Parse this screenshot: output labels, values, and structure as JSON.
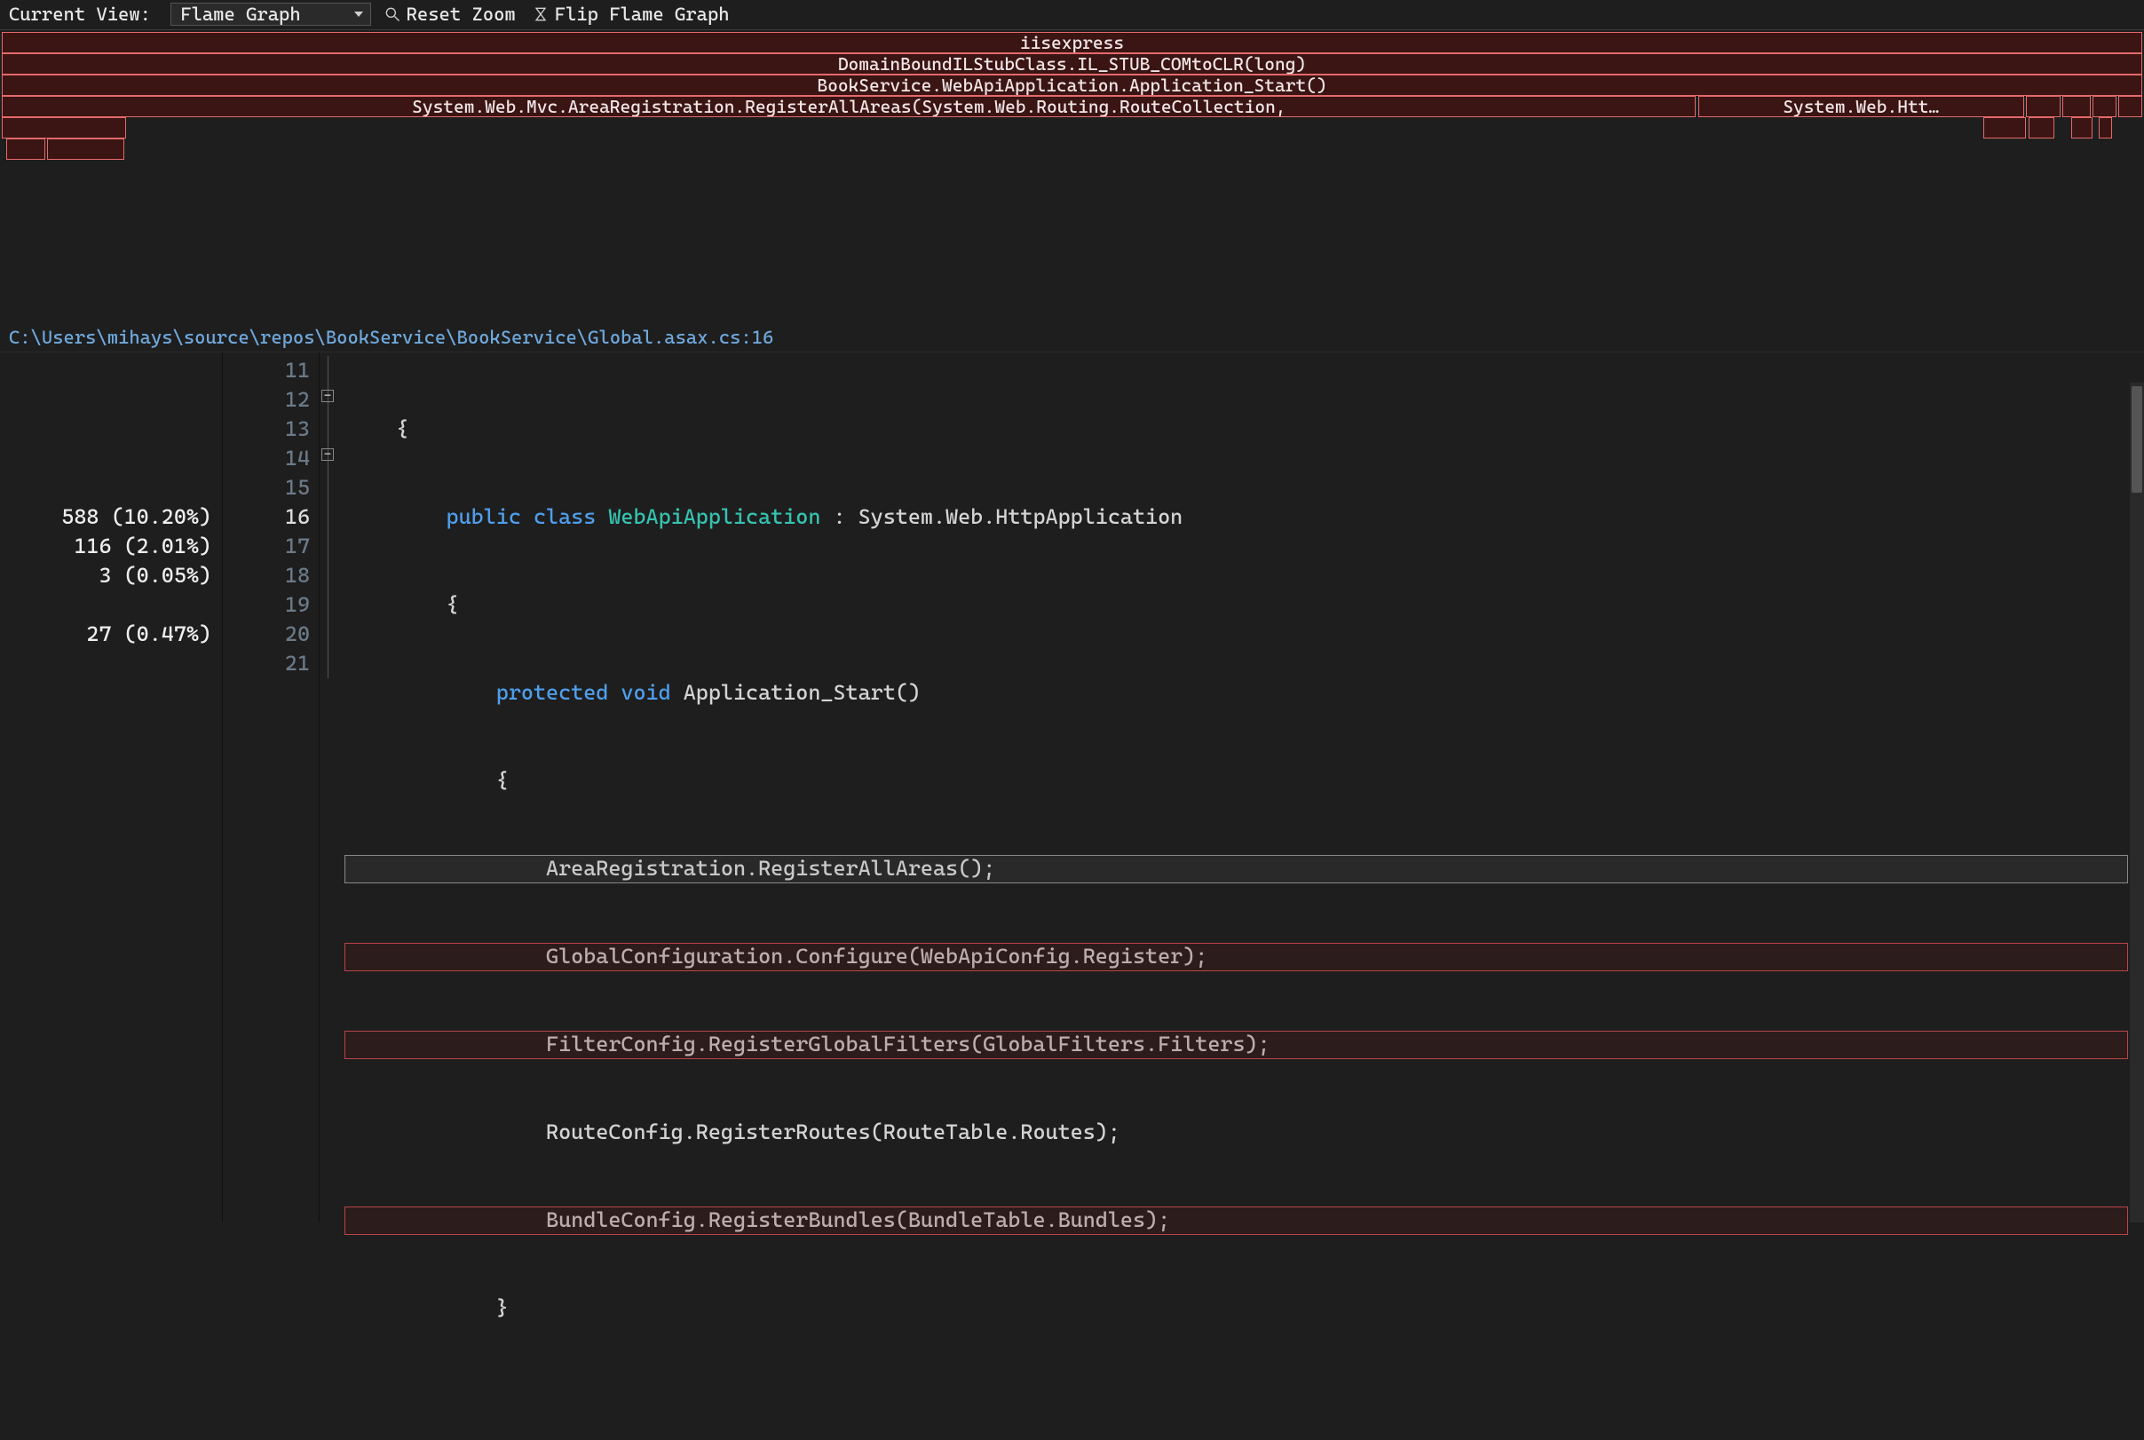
{
  "toolbar": {
    "view_label": "Current View: ",
    "view_value": "Flame Graph",
    "reset_zoom": "Reset Zoom",
    "flip_flame": "Flip Flame Graph"
  },
  "flame": {
    "rows": [
      [
        {
          "left": 0.1,
          "width": 99.8,
          "label": "iisexpress"
        }
      ],
      [
        {
          "left": 0.1,
          "width": 99.8,
          "label": "DomainBoundILStubClass.IL_STUB_COMtoCLR(long)"
        }
      ],
      [
        {
          "left": 0.1,
          "width": 99.8,
          "label": "BookService.WebApiApplication.Application_Start()"
        }
      ],
      [
        {
          "left": 0.1,
          "width": 79.0,
          "label": "System.Web.Mvc.AreaRegistration.RegisterAllAreas(System.Web.Routing.RouteCollection,"
        },
        {
          "left": 79.2,
          "width": 15.2,
          "label": "System.Web.Htt…"
        },
        {
          "left": 94.5,
          "width": 1.6,
          "label": ""
        },
        {
          "left": 96.2,
          "width": 1.3,
          "label": ""
        },
        {
          "left": 97.6,
          "width": 1.1,
          "label": ""
        },
        {
          "left": 98.8,
          "width": 1.1,
          "label": ""
        }
      ],
      [
        {
          "left": 0.1,
          "width": 5.8,
          "label": ""
        },
        {
          "left": 92.5,
          "width": 2.0,
          "label": ""
        },
        {
          "left": 94.6,
          "width": 1.2,
          "label": ""
        },
        {
          "left": 96.6,
          "width": 1.0,
          "label": ""
        },
        {
          "left": 97.9,
          "width": 0.6,
          "label": ""
        }
      ],
      [
        {
          "left": 0.3,
          "width": 1.8,
          "label": ""
        },
        {
          "left": 2.2,
          "width": 3.6,
          "label": ""
        }
      ]
    ]
  },
  "path": "C:\\Users\\mihays\\source\\repos\\BookService\\BookService\\Global.asax.cs:16",
  "metrics": {
    "l16": "588 (10.20%)",
    "l17": "116 (2.01%)",
    "l18": "3 (0.05%)",
    "l20": "27 (0.47%)"
  },
  "lines": {
    "n11": "11",
    "n12": "12",
    "n13": "13",
    "n14": "14",
    "n15": "15",
    "n16": "16",
    "n17": "17",
    "n18": "18",
    "n19": "19",
    "n20": "20",
    "n21": "21"
  },
  "code": {
    "l11": "    {",
    "l12_kw1": "public",
    "l12_kw2": "class",
    "l12_type": "WebApiApplication",
    "l12_rest": " : System.Web.HttpApplication",
    "l13": "        {",
    "l14_kw1": "protected",
    "l14_kw2": "void",
    "l14_rest": " Application_Start()",
    "l15": "            {",
    "l16": "                AreaRegistration.RegisterAllAreas();",
    "l17": "                GlobalConfiguration.Configure(WebApiConfig.Register);",
    "l18": "                FilterConfig.RegisterGlobalFilters(GlobalFilters.Filters);",
    "l19": "                RouteConfig.RegisterRoutes(RouteTable.Routes);",
    "l20": "                BundleConfig.RegisterBundles(BundleTable.Bundles);",
    "l21": "            }"
  }
}
